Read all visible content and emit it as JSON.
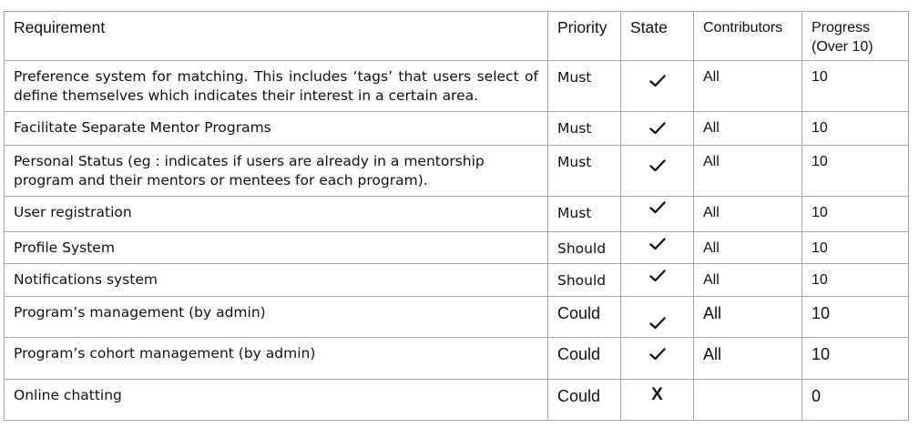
{
  "table": {
    "headers": {
      "requirement": "Requirement",
      "priority": "Priority",
      "state": "State",
      "contributors": "Contributors",
      "progress": "Progress",
      "progress_sub": "(Over 10)"
    },
    "rows": [
      {
        "requirement": "Preference system for matching. This includes ‘tags’ that users select of define themselves which indicates their interest in a certain area.",
        "priority": "Must",
        "state": "done",
        "state_icon": "check-icon",
        "contributors": "All",
        "progress": "10"
      },
      {
        "requirement": "Facilitate Separate Mentor Programs",
        "priority": "Must",
        "state": "done",
        "state_icon": "check-icon",
        "contributors": "All",
        "progress": "10"
      },
      {
        "requirement": "Personal Status (eg : indicates if users are already in a mentorship program and their mentors or mentees for each program).",
        "priority": "Must",
        "state": "done",
        "state_icon": "check-icon",
        "contributors": "All",
        "progress": "10"
      },
      {
        "requirement": "User registration",
        "priority": "Must",
        "state": "done",
        "state_icon": "check-icon",
        "contributors": "All",
        "progress": "10"
      },
      {
        "requirement": "Profile System",
        "priority": "Should",
        "state": "done",
        "state_icon": "check-icon",
        "contributors": "All",
        "progress": "10"
      },
      {
        "requirement": "Notifications system",
        "priority": "Should",
        "state": "done",
        "state_icon": "check-icon",
        "contributors": "All",
        "progress": "10"
      },
      {
        "requirement": "Program’s management (by admin)",
        "priority": "Could",
        "state": "done",
        "state_icon": "check-icon",
        "contributors": "All",
        "progress": "10"
      },
      {
        "requirement": "Program’s cohort management (by admin)",
        "priority": "Could",
        "state": "done",
        "state_icon": "check-icon",
        "contributors": "All",
        "progress": "10"
      },
      {
        "requirement": "Online chatting",
        "priority": "Could",
        "state": "not-done",
        "state_mark": "X",
        "state_icon": "cross-icon",
        "contributors": "",
        "progress": "0"
      }
    ]
  }
}
